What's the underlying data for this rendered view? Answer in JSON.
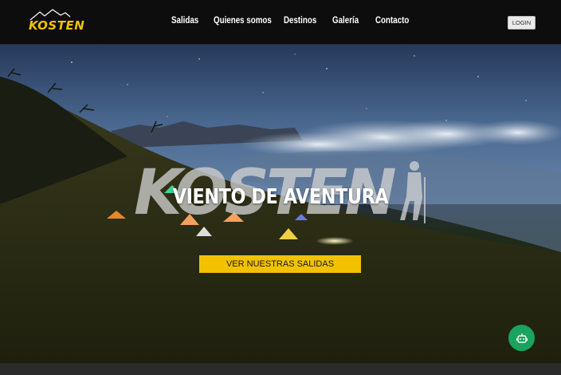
{
  "brand": {
    "logo_text": "KOSTEN",
    "accent_color": "#f2c200"
  },
  "nav": {
    "items": [
      {
        "label": "Salidas"
      },
      {
        "label": "Quienes somos"
      },
      {
        "label": "Destinos"
      },
      {
        "label": "Galería"
      },
      {
        "label": "Contacto"
      }
    ],
    "login_label": "LOGIN"
  },
  "hero": {
    "title": "VIENTO DE AVENTURA",
    "watermark_text": "KOSTEN",
    "cta_label": "VER NUESTRAS SALIDAS"
  },
  "chat": {
    "icon": "robot-icon",
    "color": "#19a35f"
  }
}
